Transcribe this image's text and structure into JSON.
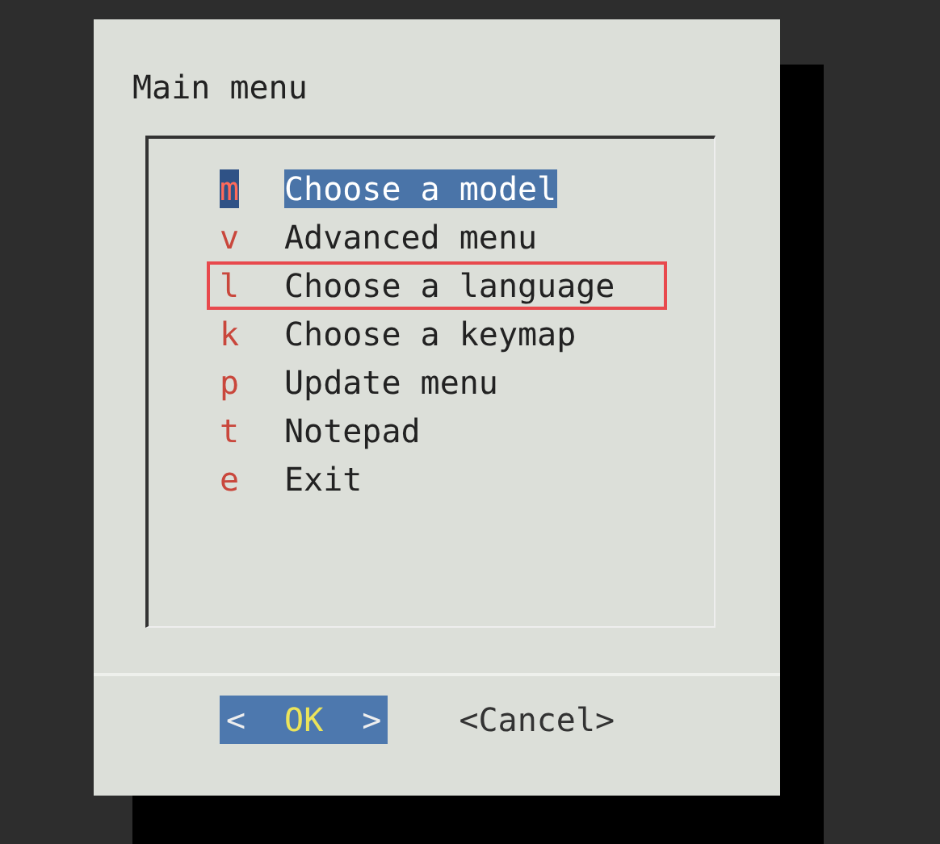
{
  "dialog": {
    "title": "Main menu"
  },
  "menu": [
    {
      "hotkey": "m",
      "label": "Choose a model",
      "selected": true,
      "highlighted": false
    },
    {
      "hotkey": "v",
      "label": "Advanced menu",
      "selected": false,
      "highlighted": false
    },
    {
      "hotkey": "l",
      "label": "Choose a language",
      "selected": false,
      "highlighted": true
    },
    {
      "hotkey": "k",
      "label": "Choose a keymap",
      "selected": false,
      "highlighted": false
    },
    {
      "hotkey": "p",
      "label": "Update menu",
      "selected": false,
      "highlighted": false
    },
    {
      "hotkey": "t",
      "label": "Notepad",
      "selected": false,
      "highlighted": false
    },
    {
      "hotkey": "e",
      "label": "Exit",
      "selected": false,
      "highlighted": false
    }
  ],
  "buttons": [
    {
      "left": "<",
      "label": "OK",
      "right": ">",
      "selected": true
    },
    {
      "left": "<",
      "label": "Cancel",
      "right": ">",
      "selected": false
    }
  ]
}
